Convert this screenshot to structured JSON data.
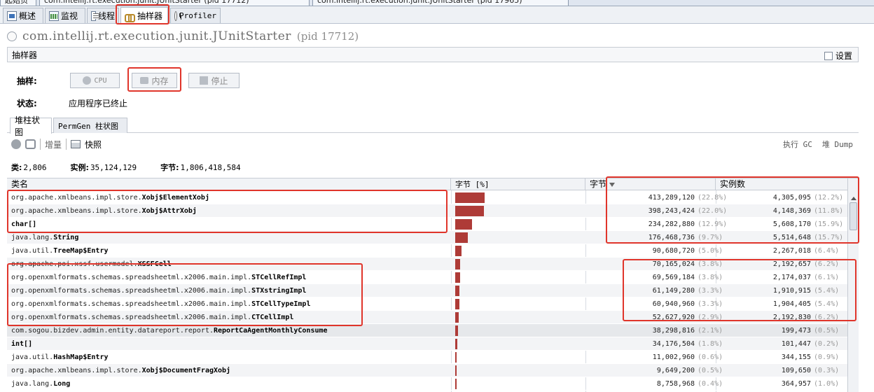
{
  "window_tabs": [
    {
      "label": "起始页"
    },
    {
      "label": "com.intellij.rt.execution.junit.JUnitStarter (pid 17712)"
    },
    {
      "label": "com.intellij.rt.execution.junit.JUnitStarter (pid 17965)"
    }
  ],
  "app_tabs": [
    {
      "label": "概述",
      "icon": "overview-icon"
    },
    {
      "label": "监视",
      "icon": "monitor-icon"
    },
    {
      "label": "线程",
      "icon": "threads-icon"
    },
    {
      "label": "抽样器",
      "icon": "sampler-icon",
      "active": true
    },
    {
      "label": "Profiler",
      "icon": "profiler-icon"
    }
  ],
  "title": {
    "app": "com.intellij.rt.execution.junit.JUnitStarter",
    "pid": "(pid 17712)"
  },
  "section": {
    "title": "抽样器",
    "settings_label": "设置"
  },
  "sampling": {
    "label": "抽样:",
    "cpu_label": "CPU",
    "memory_label": "内存",
    "stop_label": "停止",
    "status_label": "状态:",
    "status_value": "应用程序已终止"
  },
  "subtabs": [
    {
      "label": "堆柱状图",
      "active": true
    },
    {
      "label": "PermGen 柱状图"
    }
  ],
  "toolbar": {
    "delta_label": "增量",
    "snapshot_label": "快照",
    "gc_label": "执行 GC",
    "heapdump_label": "堆 Dump"
  },
  "stats": {
    "classes_label": "类:",
    "classes_value": "2,806",
    "instances_label": "实例:",
    "instances_value": "35,124,129",
    "bytes_label": "字节:",
    "bytes_value": "1,806,418,584"
  },
  "table": {
    "columns": {
      "name": "类名",
      "bytes_pct": "字节 [%]",
      "bytes": "字节",
      "instances": "实例数"
    },
    "rows": [
      {
        "pkg": "org.apache.xmlbeans.impl.store.",
        "cls": "Xobj$ElementXobj",
        "pct": 22.8,
        "bytes": "413,289,120",
        "bytes_pct": "(22.8%)",
        "instances": "4,305,095",
        "inst_pct": "(12.2%)"
      },
      {
        "pkg": "org.apache.xmlbeans.impl.store.",
        "cls": "Xobj$AttrXobj",
        "pct": 22.0,
        "bytes": "398,243,424",
        "bytes_pct": "(22.0%)",
        "instances": "4,148,369",
        "inst_pct": "(11.8%)"
      },
      {
        "pkg": "",
        "cls": "char[]",
        "pct": 12.9,
        "bytes": "234,282,880",
        "bytes_pct": "(12.9%)",
        "instances": "5,608,170",
        "inst_pct": "(15.9%)"
      },
      {
        "pkg": "java.lang.",
        "cls": "String",
        "pct": 9.7,
        "bytes": "176,468,736",
        "bytes_pct": "(9.7%)",
        "instances": "5,514,648",
        "inst_pct": "(15.7%)"
      },
      {
        "pkg": "java.util.",
        "cls": "TreeMap$Entry",
        "pct": 5.0,
        "bytes": "90,680,720",
        "bytes_pct": "(5.0%)",
        "instances": "2,267,018",
        "inst_pct": "(6.4%)"
      },
      {
        "pkg": "org.apache.poi.xssf.usermodel.",
        "cls": "XSSFCell",
        "pct": 3.8,
        "bytes": "70,165,024",
        "bytes_pct": "(3.8%)",
        "instances": "2,192,657",
        "inst_pct": "(6.2%)"
      },
      {
        "pkg": "org.openxmlformats.schemas.spreadsheetml.x2006.main.impl.",
        "cls": "STCellRefImpl",
        "pct": 3.8,
        "bytes": "69,569,184",
        "bytes_pct": "(3.8%)",
        "instances": "2,174,037",
        "inst_pct": "(6.1%)"
      },
      {
        "pkg": "org.openxmlformats.schemas.spreadsheetml.x2006.main.impl.",
        "cls": "STXstringImpl",
        "pct": 3.3,
        "bytes": "61,149,280",
        "bytes_pct": "(3.3%)",
        "instances": "1,910,915",
        "inst_pct": "(5.4%)"
      },
      {
        "pkg": "org.openxmlformats.schemas.spreadsheetml.x2006.main.impl.",
        "cls": "STCellTypeImpl",
        "pct": 3.3,
        "bytes": "60,940,960",
        "bytes_pct": "(3.3%)",
        "instances": "1,904,405",
        "inst_pct": "(5.4%)"
      },
      {
        "pkg": "org.openxmlformats.schemas.spreadsheetml.x2006.main.impl.",
        "cls": "CTCellImpl",
        "pct": 2.9,
        "bytes": "52,627,920",
        "bytes_pct": "(2.9%)",
        "instances": "2,192,830",
        "inst_pct": "(6.2%)"
      },
      {
        "pkg": "com.sogou.bizdev.admin.entity.datareport.report.",
        "cls": "ReportCaAgentMonthlyConsume",
        "pct": 2.1,
        "bytes": "38,298,816",
        "bytes_pct": "(2.1%)",
        "instances": "199,473",
        "inst_pct": "(0.5%)"
      },
      {
        "pkg": "",
        "cls": "int[]",
        "pct": 1.8,
        "bytes": "34,176,504",
        "bytes_pct": "(1.8%)",
        "instances": "101,447",
        "inst_pct": "(0.2%)"
      },
      {
        "pkg": "java.util.",
        "cls": "HashMap$Entry",
        "pct": 0.6,
        "bytes": "11,002,960",
        "bytes_pct": "(0.6%)",
        "instances": "344,155",
        "inst_pct": "(0.9%)"
      },
      {
        "pkg": "org.apache.xmlbeans.impl.store.",
        "cls": "Xobj$DocumentFragXobj",
        "pct": 0.5,
        "bytes": "9,649,200",
        "bytes_pct": "(0.5%)",
        "instances": "109,650",
        "inst_pct": "(0.3%)"
      },
      {
        "pkg": "java.lang.",
        "cls": "Long",
        "pct": 0.4,
        "bytes": "8,758,968",
        "bytes_pct": "(0.4%)",
        "instances": "364,957",
        "inst_pct": "(1.0%)"
      }
    ]
  },
  "colors": {
    "bar": "#ae3b37",
    "annotation": "#e0352b"
  }
}
